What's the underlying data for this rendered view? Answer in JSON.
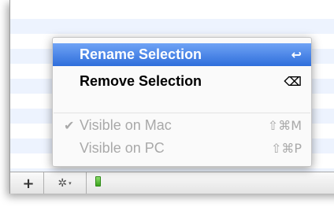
{
  "menu": {
    "items": [
      {
        "label": "Rename Selection",
        "shortcut": "↩",
        "check": "",
        "state": "selected"
      },
      {
        "label": "Remove Selection",
        "shortcut": "⌫",
        "check": "",
        "state": "enabled"
      },
      {
        "label": "Visible on Mac",
        "shortcut": "⇧⌘M",
        "check": "✔",
        "state": "disabled"
      },
      {
        "label": "Visible on PC",
        "shortcut": "⇧⌘P",
        "check": "",
        "state": "disabled"
      }
    ]
  },
  "toolbar": {
    "add_label": "+",
    "gear_label": "✲",
    "gear_chevron": "▾"
  },
  "colors": {
    "selection": "#3b7ae3",
    "stripe": "#edf3fe",
    "indicator": "#4cc42a",
    "disabled_text": "#a9a9a9"
  }
}
